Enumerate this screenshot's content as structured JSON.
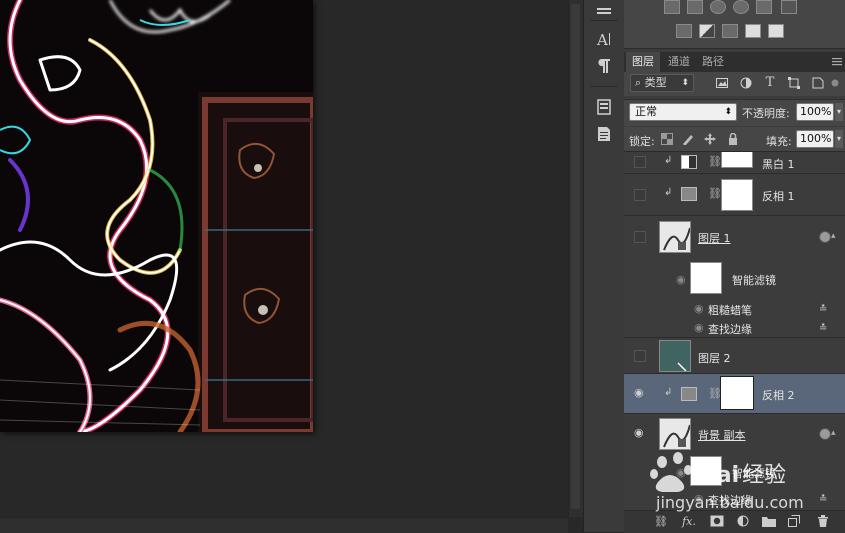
{
  "layers_panel": {
    "tabs": [
      "图层",
      "通道",
      "路径"
    ],
    "kind_filter": "类型",
    "blend_mode": "正常",
    "opacity_label": "不透明度:",
    "opacity_value": "100%",
    "lock_label": "锁定:",
    "fill_label": "填充:",
    "fill_value": "100%",
    "layers": [
      {
        "name": "黑白 1",
        "visible": false,
        "type": "adjustment"
      },
      {
        "name": "反相 1",
        "visible": false,
        "type": "adjustment"
      },
      {
        "name": "图层 1",
        "visible": false,
        "type": "smart-object"
      },
      {
        "name": "智能滤镜",
        "type": "smart-filters"
      },
      {
        "name": "粗糙蜡笔",
        "type": "filter"
      },
      {
        "name": "查找边缘",
        "type": "filter"
      },
      {
        "name": "图层 2",
        "visible": false,
        "type": "fill"
      },
      {
        "name": "反相 2",
        "visible": true,
        "selected": true,
        "type": "adjustment"
      },
      {
        "name": "背景 副本",
        "visible": true,
        "type": "smart-object"
      },
      {
        "name": "智能滤镜",
        "type": "smart-filters"
      },
      {
        "name": "查找边缘",
        "type": "filter"
      }
    ],
    "bottom_icons": [
      "link-icon",
      "fx-icon",
      "mask-icon",
      "adjustment-icon",
      "folder-icon",
      "new-layer-icon",
      "trash-icon"
    ]
  },
  "watermark": {
    "brand": "Baidu经验",
    "url": "jingyan.baidu.com"
  },
  "colors": {
    "panel": "#3c3c3c",
    "selected_row": "#5a6679",
    "canvas_bg": "#282828"
  }
}
